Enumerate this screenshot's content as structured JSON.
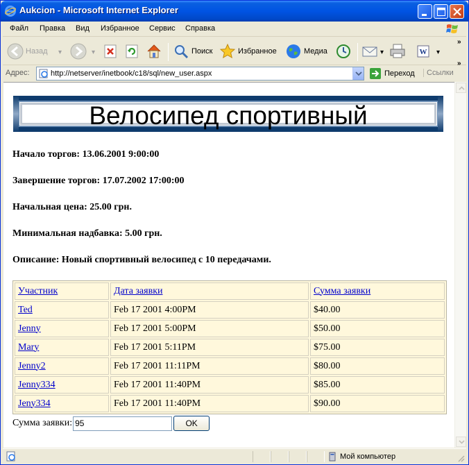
{
  "window": {
    "title": "Aukcion - Microsoft Internet Explorer"
  },
  "menu": [
    "Файл",
    "Правка",
    "Вид",
    "Избранное",
    "Сервис",
    "Справка"
  ],
  "toolbar": {
    "back": "Назад",
    "search": "Поиск",
    "favorites": "Избранное",
    "media": "Медиа"
  },
  "address": {
    "label": "Адрес:",
    "url": "http://netserver/inetbook/c18/sql/new_user.aspx",
    "go": "Переход",
    "links": "Ссылки"
  },
  "page": {
    "banner": "Велосипед спортивный",
    "start": "Начало торгов: 13.06.2001 9:00:00",
    "end": "Завершение торгов: 17.07.2002 17:00:00",
    "start_price": "Начальная цена: 25.00 грн.",
    "min_step": "Минимальная надбавка: 5.00 грн.",
    "description": "Описание: Новый спортивный велосипед с 10 передачами.",
    "table": {
      "headers": [
        "Участник",
        "Дата заявки",
        "Сумма заявки"
      ],
      "rows": [
        {
          "user": "Ted",
          "date": "Feb 17 2001 4:00PM",
          "amount": "$40.00"
        },
        {
          "user": "Jenny",
          "date": "Feb 17 2001 5:00PM",
          "amount": "$50.00"
        },
        {
          "user": "Mary",
          "date": "Feb 17 2001 5:11PM",
          "amount": "$75.00"
        },
        {
          "user": "Jenny2",
          "date": "Feb 17 2001 11:11PM",
          "amount": "$80.00"
        },
        {
          "user": "Jenny334",
          "date": "Feb 17 2001 11:40PM",
          "amount": "$85.00"
        },
        {
          "user": "Jeny334",
          "date": "Feb 17 2001 11:40PM",
          "amount": "$90.00"
        }
      ]
    },
    "bid_label": "Сумма заявки:",
    "bid_value": "95",
    "ok_label": "OK"
  },
  "status": {
    "zone": "Мой компьютер"
  },
  "colors": {
    "titlebar": "#0054e3",
    "table_bg": "#fff8dc",
    "link": "#0000cc",
    "banner_frame": "#0e3b6d"
  }
}
